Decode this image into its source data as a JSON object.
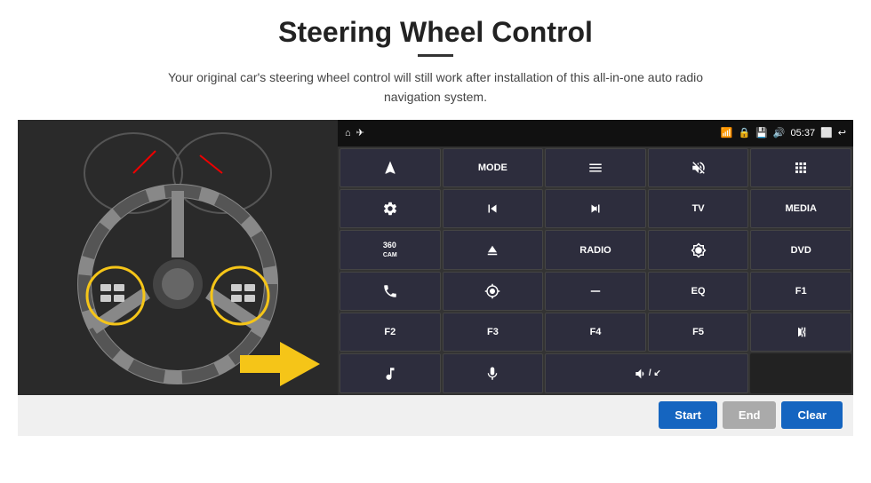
{
  "page": {
    "title": "Steering Wheel Control",
    "subtitle": "Your original car's steering wheel control will still work after installation of this all-in-one auto radio navigation system."
  },
  "status_bar": {
    "time": "05:37",
    "home_icon": "⌂",
    "nav_icon": "◁"
  },
  "buttons": [
    [
      {
        "label": "↗",
        "type": "icon",
        "id": "navigation"
      },
      {
        "label": "MODE",
        "type": "text",
        "id": "mode"
      },
      {
        "label": "☰",
        "type": "icon",
        "id": "menu"
      },
      {
        "label": "🔇",
        "type": "icon",
        "id": "mute"
      },
      {
        "label": "⠿",
        "type": "icon",
        "id": "apps"
      }
    ],
    [
      {
        "label": "⚙",
        "type": "icon",
        "id": "settings"
      },
      {
        "label": "⏮",
        "type": "icon",
        "id": "prev"
      },
      {
        "label": "⏭",
        "type": "icon",
        "id": "next"
      },
      {
        "label": "TV",
        "type": "text",
        "id": "tv"
      },
      {
        "label": "MEDIA",
        "type": "text",
        "id": "media"
      }
    ],
    [
      {
        "label": "360",
        "type": "text-small",
        "id": "360cam"
      },
      {
        "label": "▲",
        "type": "icon",
        "id": "eject"
      },
      {
        "label": "RADIO",
        "type": "text",
        "id": "radio"
      },
      {
        "label": "☀",
        "type": "icon",
        "id": "brightness"
      },
      {
        "label": "DVD",
        "type": "text",
        "id": "dvd"
      }
    ],
    [
      {
        "label": "📞",
        "type": "icon",
        "id": "phone"
      },
      {
        "label": "◎",
        "type": "icon",
        "id": "gps"
      },
      {
        "label": "▬",
        "type": "icon",
        "id": "dash"
      },
      {
        "label": "EQ",
        "type": "text",
        "id": "eq"
      },
      {
        "label": "F1",
        "type": "text",
        "id": "f1"
      }
    ],
    [
      {
        "label": "F2",
        "type": "text",
        "id": "f2"
      },
      {
        "label": "F3",
        "type": "text",
        "id": "f3"
      },
      {
        "label": "F4",
        "type": "text",
        "id": "f4"
      },
      {
        "label": "F5",
        "type": "text",
        "id": "f5"
      },
      {
        "label": "▶⏸",
        "type": "icon",
        "id": "playpause"
      }
    ],
    [
      {
        "label": "♪",
        "type": "icon",
        "id": "music"
      },
      {
        "label": "🎤",
        "type": "icon",
        "id": "mic"
      },
      {
        "label": "🔊↙",
        "type": "icon",
        "id": "voldown"
      },
      {
        "label": "",
        "type": "empty",
        "id": "empty1"
      },
      {
        "label": "",
        "type": "empty",
        "id": "empty2"
      }
    ]
  ],
  "bottom_buttons": {
    "start": "Start",
    "end": "End",
    "clear": "Clear"
  }
}
